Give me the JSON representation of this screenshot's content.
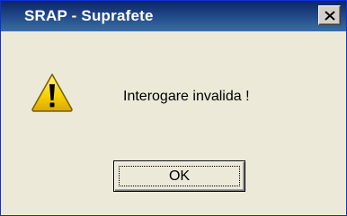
{
  "window": {
    "title": "SRAP - Suprafete",
    "close_symbol": "close-icon"
  },
  "dialog": {
    "icon": "warning-icon",
    "message": "Interogare invalida !",
    "ok_label": "OK"
  },
  "colors": {
    "titlebar_start": "#0a246a",
    "titlebar_end": "#3a6ea5",
    "window_bg": "#ece9d8",
    "warning_yellow": "#f5d000"
  }
}
